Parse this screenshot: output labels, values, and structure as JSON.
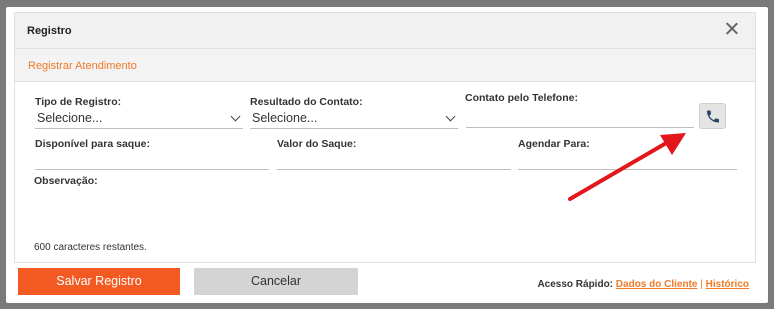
{
  "modal": {
    "title": "Registro",
    "section_title": "Registrar Atendimento"
  },
  "form": {
    "tipo_registro": {
      "label": "Tipo de Registro:",
      "value": "Selecione..."
    },
    "resultado_contato": {
      "label": "Resultado do Contato:",
      "value": "Selecione..."
    },
    "contato_telefone": {
      "label": "Contato pelo Telefone:",
      "value": ""
    },
    "disponivel_saque": {
      "label": "Disponível para saque:",
      "value": ""
    },
    "valor_saque": {
      "label": "Valor do Saque:",
      "value": ""
    },
    "agendar_para": {
      "label": "Agendar Para:",
      "value": ""
    },
    "observacao": {
      "label": "Observação:",
      "value": ""
    },
    "chars_remaining": "600 caracteres restantes."
  },
  "footer": {
    "save_label": "Salvar Registro",
    "cancel_label": "Cancelar",
    "quick_access_label": "Acesso Rápido:",
    "link_dados": "Dados do Cliente",
    "separator": "|",
    "link_historico": "Histórico"
  },
  "icons": {
    "close": "close-icon",
    "phone": "phone-icon",
    "chevron": "chevron-down-icon"
  },
  "colors": {
    "accent": "#f07a26",
    "primary_button": "#f25a22",
    "secondary_button": "#d4d4d4",
    "annotation_arrow": "#e3161b"
  }
}
